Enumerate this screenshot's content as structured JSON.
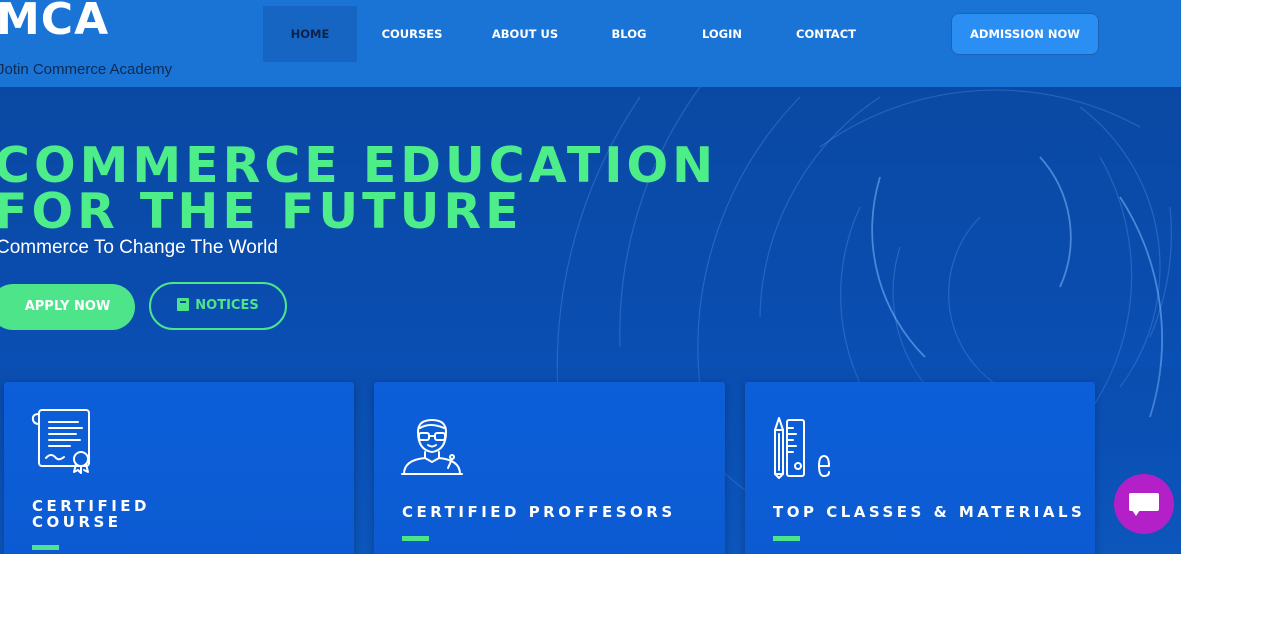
{
  "header": {
    "logo": "MCA",
    "tagline": "Jotin Commerce Academy",
    "nav": [
      {
        "label": "HOME",
        "active": true
      },
      {
        "label": "COURSES",
        "active": false
      },
      {
        "label": "ABOUT US",
        "active": false
      },
      {
        "label": "BLOG",
        "active": false
      },
      {
        "label": "LOGIN",
        "active": false
      },
      {
        "label": "CONTACT",
        "active": false
      }
    ],
    "admission_label": "ADMISSION NOW"
  },
  "hero": {
    "title_line1": "COMMERCE EDUCATION",
    "title_line2": "FOR THE FUTURE",
    "subtitle": "Commerce To Change The World",
    "apply_label": "APPLY NOW",
    "notices_label": "NOTICES"
  },
  "cards": [
    {
      "title_line1": "CERTIFIED",
      "title_line2": "COURSE",
      "icon": "certificate-icon"
    },
    {
      "title_line1": "CERTIFIED PROFFESORS",
      "title_line2": "",
      "icon": "professor-icon"
    },
    {
      "title_line1": "TOP CLASSES & MATERIALS",
      "title_line2": "",
      "icon": "stationery-icon"
    }
  ],
  "colors": {
    "header_bg": "#1a74d6",
    "hero_bg": "#0a4aa6",
    "accent_green": "#4ee58a",
    "card_bg": "#0c5fd9",
    "admission_btn": "#2b8ef2",
    "chat_bubble": "#b320c7"
  },
  "chat": {
    "icon": "chat-icon"
  }
}
